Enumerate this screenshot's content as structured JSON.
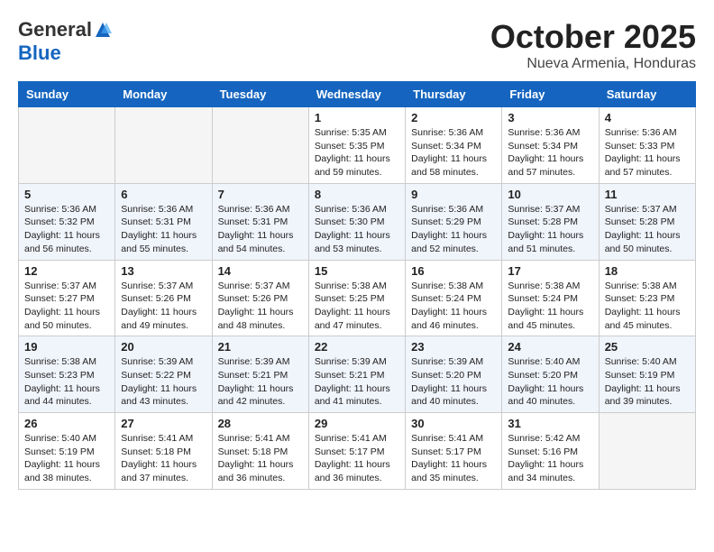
{
  "header": {
    "logo_general": "General",
    "logo_blue": "Blue",
    "month": "October 2025",
    "location": "Nueva Armenia, Honduras"
  },
  "days_of_week": [
    "Sunday",
    "Monday",
    "Tuesday",
    "Wednesday",
    "Thursday",
    "Friday",
    "Saturday"
  ],
  "weeks": [
    [
      {
        "day": "",
        "info": ""
      },
      {
        "day": "",
        "info": ""
      },
      {
        "day": "",
        "info": ""
      },
      {
        "day": "1",
        "info": "Sunrise: 5:35 AM\nSunset: 5:35 PM\nDaylight: 11 hours\nand 59 minutes."
      },
      {
        "day": "2",
        "info": "Sunrise: 5:36 AM\nSunset: 5:34 PM\nDaylight: 11 hours\nand 58 minutes."
      },
      {
        "day": "3",
        "info": "Sunrise: 5:36 AM\nSunset: 5:34 PM\nDaylight: 11 hours\nand 57 minutes."
      },
      {
        "day": "4",
        "info": "Sunrise: 5:36 AM\nSunset: 5:33 PM\nDaylight: 11 hours\nand 57 minutes."
      }
    ],
    [
      {
        "day": "5",
        "info": "Sunrise: 5:36 AM\nSunset: 5:32 PM\nDaylight: 11 hours\nand 56 minutes."
      },
      {
        "day": "6",
        "info": "Sunrise: 5:36 AM\nSunset: 5:31 PM\nDaylight: 11 hours\nand 55 minutes."
      },
      {
        "day": "7",
        "info": "Sunrise: 5:36 AM\nSunset: 5:31 PM\nDaylight: 11 hours\nand 54 minutes."
      },
      {
        "day": "8",
        "info": "Sunrise: 5:36 AM\nSunset: 5:30 PM\nDaylight: 11 hours\nand 53 minutes."
      },
      {
        "day": "9",
        "info": "Sunrise: 5:36 AM\nSunset: 5:29 PM\nDaylight: 11 hours\nand 52 minutes."
      },
      {
        "day": "10",
        "info": "Sunrise: 5:37 AM\nSunset: 5:28 PM\nDaylight: 11 hours\nand 51 minutes."
      },
      {
        "day": "11",
        "info": "Sunrise: 5:37 AM\nSunset: 5:28 PM\nDaylight: 11 hours\nand 50 minutes."
      }
    ],
    [
      {
        "day": "12",
        "info": "Sunrise: 5:37 AM\nSunset: 5:27 PM\nDaylight: 11 hours\nand 50 minutes."
      },
      {
        "day": "13",
        "info": "Sunrise: 5:37 AM\nSunset: 5:26 PM\nDaylight: 11 hours\nand 49 minutes."
      },
      {
        "day": "14",
        "info": "Sunrise: 5:37 AM\nSunset: 5:26 PM\nDaylight: 11 hours\nand 48 minutes."
      },
      {
        "day": "15",
        "info": "Sunrise: 5:38 AM\nSunset: 5:25 PM\nDaylight: 11 hours\nand 47 minutes."
      },
      {
        "day": "16",
        "info": "Sunrise: 5:38 AM\nSunset: 5:24 PM\nDaylight: 11 hours\nand 46 minutes."
      },
      {
        "day": "17",
        "info": "Sunrise: 5:38 AM\nSunset: 5:24 PM\nDaylight: 11 hours\nand 45 minutes."
      },
      {
        "day": "18",
        "info": "Sunrise: 5:38 AM\nSunset: 5:23 PM\nDaylight: 11 hours\nand 45 minutes."
      }
    ],
    [
      {
        "day": "19",
        "info": "Sunrise: 5:38 AM\nSunset: 5:23 PM\nDaylight: 11 hours\nand 44 minutes."
      },
      {
        "day": "20",
        "info": "Sunrise: 5:39 AM\nSunset: 5:22 PM\nDaylight: 11 hours\nand 43 minutes."
      },
      {
        "day": "21",
        "info": "Sunrise: 5:39 AM\nSunset: 5:21 PM\nDaylight: 11 hours\nand 42 minutes."
      },
      {
        "day": "22",
        "info": "Sunrise: 5:39 AM\nSunset: 5:21 PM\nDaylight: 11 hours\nand 41 minutes."
      },
      {
        "day": "23",
        "info": "Sunrise: 5:39 AM\nSunset: 5:20 PM\nDaylight: 11 hours\nand 40 minutes."
      },
      {
        "day": "24",
        "info": "Sunrise: 5:40 AM\nSunset: 5:20 PM\nDaylight: 11 hours\nand 40 minutes."
      },
      {
        "day": "25",
        "info": "Sunrise: 5:40 AM\nSunset: 5:19 PM\nDaylight: 11 hours\nand 39 minutes."
      }
    ],
    [
      {
        "day": "26",
        "info": "Sunrise: 5:40 AM\nSunset: 5:19 PM\nDaylight: 11 hours\nand 38 minutes."
      },
      {
        "day": "27",
        "info": "Sunrise: 5:41 AM\nSunset: 5:18 PM\nDaylight: 11 hours\nand 37 minutes."
      },
      {
        "day": "28",
        "info": "Sunrise: 5:41 AM\nSunset: 5:18 PM\nDaylight: 11 hours\nand 36 minutes."
      },
      {
        "day": "29",
        "info": "Sunrise: 5:41 AM\nSunset: 5:17 PM\nDaylight: 11 hours\nand 36 minutes."
      },
      {
        "day": "30",
        "info": "Sunrise: 5:41 AM\nSunset: 5:17 PM\nDaylight: 11 hours\nand 35 minutes."
      },
      {
        "day": "31",
        "info": "Sunrise: 5:42 AM\nSunset: 5:16 PM\nDaylight: 11 hours\nand 34 minutes."
      },
      {
        "day": "",
        "info": ""
      }
    ]
  ]
}
